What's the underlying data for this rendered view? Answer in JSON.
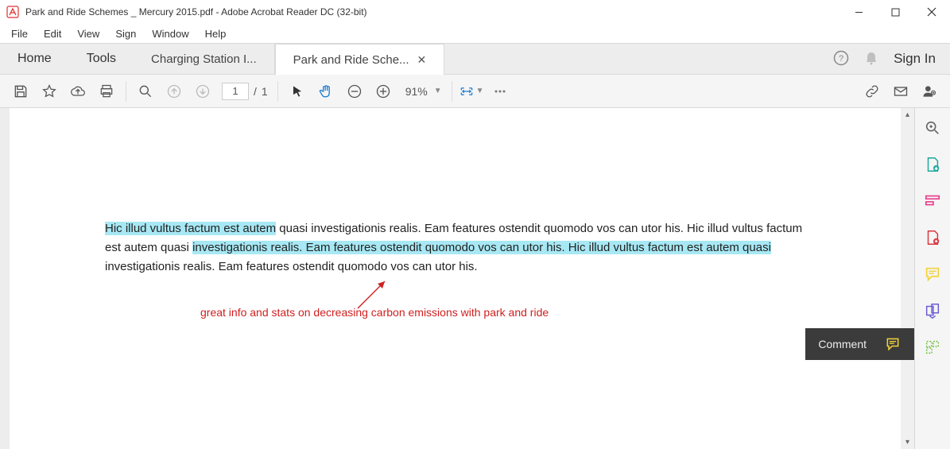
{
  "window": {
    "title": "Park and Ride Schemes _ Mercury 2015.pdf - Adobe Acrobat Reader DC (32-bit)"
  },
  "menu": {
    "file": "File",
    "edit": "Edit",
    "view": "View",
    "sign": "Sign",
    "window": "Window",
    "help": "Help"
  },
  "tabs": {
    "home": "Home",
    "tools": "Tools",
    "t1": "Charging Station I...",
    "t2": "Park and Ride Sche..."
  },
  "tabsright": {
    "signin": "Sign In"
  },
  "toolbar": {
    "page_current": "1",
    "page_sep": "/",
    "page_total": "1",
    "zoom": "91%"
  },
  "document": {
    "seg1_hl": "Hic illud vultus factum est autem",
    "seg2": " quasi investigationis realis. Eam features ostendit quomodo vos can utor his. Hic illud vultus factum est autem quasi ",
    "seg3_hl": "investigationis realis. Eam features ostendit quomodo vos can utor his. Hic illud vultus factum est autem quasi",
    "seg4": " investigationis realis. Eam features ostendit quomodo vos can utor his.",
    "annotation": "great info and stats on decreasing carbon emissions with park and ride"
  },
  "tooltip": {
    "label": "Comment"
  }
}
